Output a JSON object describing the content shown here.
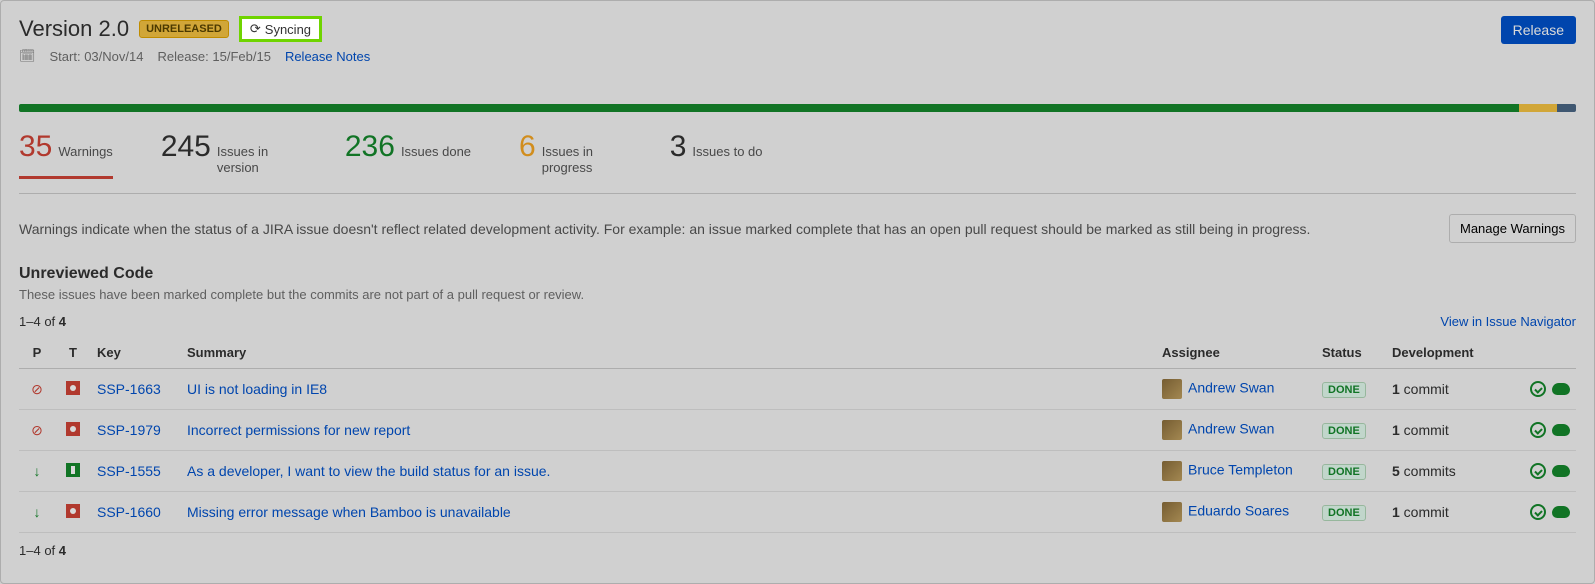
{
  "header": {
    "title": "Version 2.0",
    "badge": "UNRELEASED",
    "syncing": "Syncing",
    "start_label": "Start: 03/Nov/14",
    "release_label": "Release: 15/Feb/15",
    "release_notes": "Release Notes",
    "release_button": "Release"
  },
  "stats": {
    "warnings": {
      "count": "35",
      "label": "Warnings"
    },
    "in_version": {
      "count": "245",
      "label": "Issues in version"
    },
    "done": {
      "count": "236",
      "label": "Issues done"
    },
    "in_progress": {
      "count": "6",
      "label": "Issues in progress"
    },
    "todo": {
      "count": "3",
      "label": "Issues to do"
    }
  },
  "warnings": {
    "description": "Warnings indicate when the status of a JIRA issue doesn't reflect related development activity. For example: an issue marked complete that has an open pull request should be marked as still being in progress.",
    "manage_button": "Manage Warnings"
  },
  "section": {
    "title": "Unreviewed Code",
    "subtitle": "These issues have been marked complete but the commits are not part of a pull request or review."
  },
  "pager": {
    "text_prefix": "1–4",
    "of": " of ",
    "total": "4",
    "view_link": "View in Issue Navigator"
  },
  "columns": {
    "p": "P",
    "t": "T",
    "key": "Key",
    "summary": "Summary",
    "assignee": "Assignee",
    "status": "Status",
    "development": "Development"
  },
  "rows": [
    {
      "priority": "blocker",
      "type": "bug",
      "key": "SSP-1663",
      "summary": "UI is not loading in IE8",
      "assignee": "Andrew Swan",
      "status": "DONE",
      "dev_count": "1",
      "dev_noun": " commit"
    },
    {
      "priority": "blocker",
      "type": "bug",
      "key": "SSP-1979",
      "summary": "Incorrect permissions for new report",
      "assignee": "Andrew Swan",
      "status": "DONE",
      "dev_count": "1",
      "dev_noun": " commit"
    },
    {
      "priority": "down",
      "type": "story",
      "key": "SSP-1555",
      "summary": "As a developer, I want to view the build status for an issue.",
      "assignee": "Bruce Templeton",
      "status": "DONE",
      "dev_count": "5",
      "dev_noun": " commits"
    },
    {
      "priority": "down",
      "type": "bug",
      "key": "SSP-1660",
      "summary": "Missing error message when Bamboo is unavailable",
      "assignee": "Eduardo Soares",
      "status": "DONE",
      "dev_count": "1",
      "dev_noun": " commit"
    }
  ]
}
